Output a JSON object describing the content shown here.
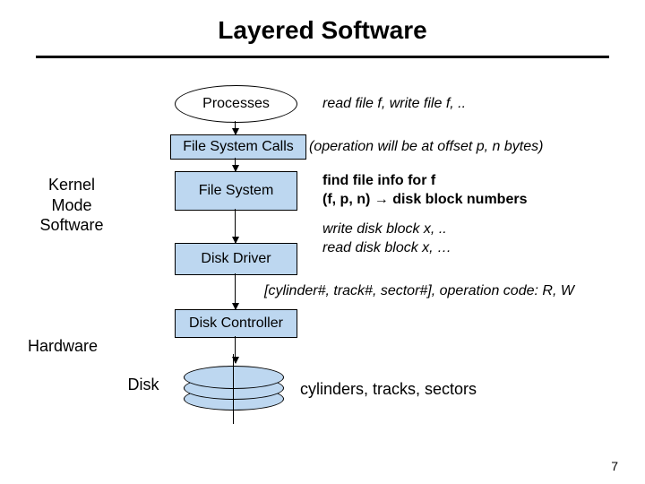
{
  "title": "Layered Software",
  "side": {
    "kernel": "Kernel\nMode\nSoftware",
    "hardware": "Hardware",
    "disk": "Disk"
  },
  "layers": {
    "processes": "Processes",
    "fs_calls": "File System Calls",
    "fs": "File System",
    "driver": "Disk Driver",
    "controller": "Disk Controller"
  },
  "notes": {
    "rw_file": "read file f, write file f, ..",
    "operation": "(operation will be at offset p, n bytes)",
    "find1": "find file info for f",
    "find2_pre": "(f, p, n) ",
    "find2_post": " disk block numbers",
    "blockrw": "write disk block x, ..\nread disk block x, …",
    "chs": "[cylinder#, track#, sector#], operation code: R, W",
    "cts": "cylinders, tracks, sectors"
  },
  "pagenum": "7"
}
